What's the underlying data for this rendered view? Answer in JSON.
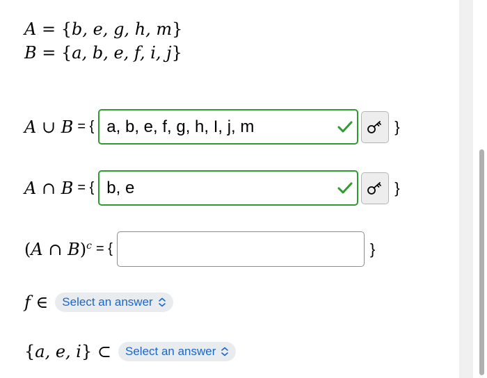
{
  "sets": {
    "a_name": "A",
    "a_elements": "b, e, g, h, m",
    "b_name": "B",
    "b_elements": "a, b, e, f, i, j"
  },
  "questions": {
    "union": {
      "lhs_a": "A",
      "op": "∪",
      "lhs_b": "B",
      "prefix": "= {",
      "suffix": "}",
      "value": "a, b, e, f, g, h, I, j, m",
      "status": "correct"
    },
    "intersection": {
      "lhs_a": "A",
      "op": "∩",
      "lhs_b": "B",
      "prefix": "= {",
      "suffix": "}",
      "value": "b, e",
      "status": "correct"
    },
    "complement": {
      "lhs_a": "A",
      "op": "∩",
      "lhs_b": "B",
      "sup": "c",
      "prefix": "= {",
      "suffix": "}",
      "value": ""
    },
    "membership": {
      "element": "f",
      "relation": "∈",
      "select_label": "Select an answer"
    },
    "subset": {
      "set": "a, e, i",
      "relation": "⊂",
      "select_label": "Select an answer"
    }
  },
  "colors": {
    "correct": "#2f9a2f",
    "link": "#1a66c9"
  },
  "icons": {
    "correct": "check-icon",
    "key": "key-icon",
    "select": "chevron-updown-icon"
  }
}
